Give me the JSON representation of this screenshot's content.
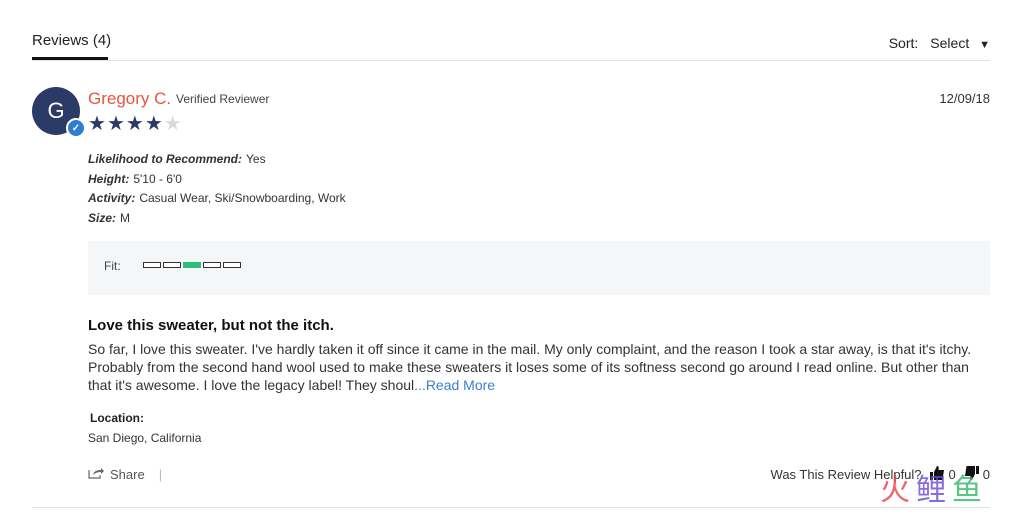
{
  "tabs": {
    "reviews_label": "Reviews (4)"
  },
  "sort": {
    "label": "Sort:",
    "value": "Select"
  },
  "review": {
    "avatar_initial": "G",
    "reviewer_name": "Gregory C.",
    "reviewer_tag": "Verified Reviewer",
    "date": "12/09/18",
    "rating": 4,
    "rating_max": 5,
    "attributes": [
      {
        "label": "Likelihood to Recommend:",
        "value": "Yes"
      },
      {
        "label": "Height:",
        "value": "5'10 - 6'0"
      },
      {
        "label": "Activity:",
        "value": "Casual Wear, Ski/Snowboarding, Work"
      },
      {
        "label": "Size:",
        "value": "M"
      }
    ],
    "fit": {
      "label": "Fit:",
      "segments": 5,
      "selected": 3
    },
    "title": "Love this sweater, but not the itch.",
    "body": "So far, I love this sweater. I've hardly taken it off since it came in the mail. My only complaint, and the reason I took a star away, is that it's itchy. Probably from the second hand wool used to make these sweaters it loses some of its softness second go around I read online. But other than that it's awesome. I love the legacy label! They shoul",
    "read_more": "...Read More",
    "location_label": "Location:",
    "location_value": "San Diego, California",
    "share_label": "Share",
    "helpful_label": "Was This Review Helpful?",
    "upvotes": "0",
    "downvotes": "0"
  },
  "colors": {
    "name": "#e8563f",
    "star": "#2b3a67",
    "fit_selected": "#2dbd7d",
    "link": "#3b7fd4"
  },
  "icons": [
    "verified-check-icon",
    "star-icon",
    "share-icon",
    "thumbs-up-icon",
    "thumbs-down-icon",
    "caret-down-icon"
  ],
  "watermark": {
    "text": "火鲤鱼"
  }
}
